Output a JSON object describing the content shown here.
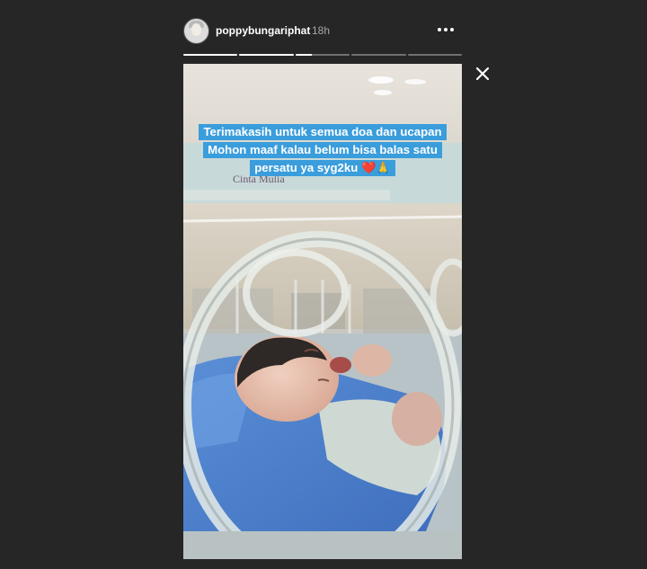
{
  "header": {
    "username": "poppybungariphat",
    "time": "18h",
    "more_icon": "ellipsis-horizontal-icon",
    "avatar_icon": "profile-avatar"
  },
  "progress": {
    "segments_total": 5,
    "segment_fill": [
      1,
      1,
      0.3,
      0,
      0
    ]
  },
  "close_icon": "close-x-icon",
  "story": {
    "caption_lines": [
      "Terimakasih untuk semua doa dan ucapan",
      "Mohon maaf kalau belum bisa balas satu",
      "persatu ya syg2ku ❤️🙏"
    ],
    "caption_bg": "#3a9ddc",
    "wall_sign": "Cinta Mulia"
  }
}
